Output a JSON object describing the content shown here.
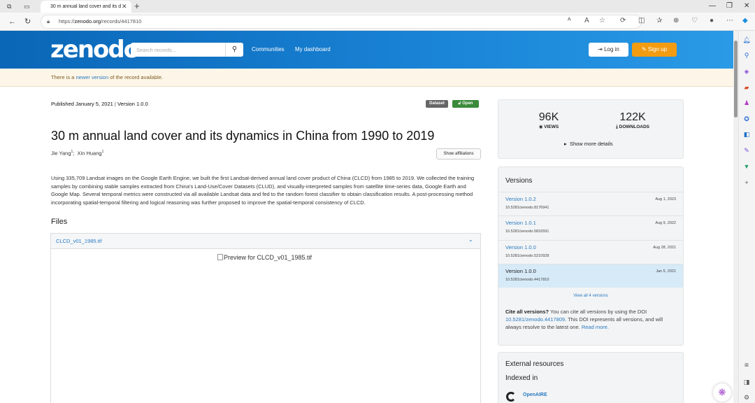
{
  "browser": {
    "tab_title": "30 m annual land cover and its d",
    "url_prefix": "https://",
    "url_domain": "zenodo.org",
    "url_path": "/records/4417810"
  },
  "header": {
    "logo": "zenodo",
    "search_placeholder": "Search records...",
    "nav": [
      "Communities",
      "My dashboard"
    ],
    "login": "Log in",
    "signup": "Sign up"
  },
  "banner": {
    "pre": "There is a ",
    "link": "newer version",
    "post": " of the record available."
  },
  "record": {
    "published": "Published January 5, 2021",
    "sep": " | ",
    "version": "Version 1.0.0",
    "badge_type": "Dataset",
    "badge_access": "Open",
    "title": "30 m annual land cover and its dynamics in China from 1990 to 2019",
    "author1": "Jie Yang",
    "author1_sup": "1",
    "author2": "Xin Huang",
    "author2_sup": "1",
    "affiliations_btn": "Show affiliations",
    "description": "Using 335,709 Landsat images on the Google Earth Engine, we built the first Landsat-derived annual land cover product of China (CLCD) from 1985 to 2019. We collected the training samples by combining stable samples extracted from China's Land-Use/Cover Datasets (CLUD), and visually-interpreted samples from satellite time-series data, Google Earth and Google Map. Several temporal metrics were constructed via all available Landsat data and fed to the random forest classifier to obtain classification results. A post-processing method incorporating spatial-temporal filtering and logical reasoning was further proposed to improve the spatial-temporal consistency of CLCD."
  },
  "files": {
    "heading": "Files",
    "filename": "CLCD_v01_1985.tif",
    "preview_alt": "Preview for CLCD_v01_1985.tif"
  },
  "stats": {
    "views": "96K",
    "views_label": "VIEWS",
    "downloads": "122K",
    "downloads_label": "DOWNLOADS",
    "more": "Show more details"
  },
  "versions": {
    "heading": "Versions",
    "items": [
      {
        "label": "Version 1.0.2",
        "doi": "10.5281/zenodo.8176941",
        "date": "Aug 1, 2023"
      },
      {
        "label": "Version 1.0.1",
        "doi": "10.5281/zenodo.5816591",
        "date": "Aug 9, 2022"
      },
      {
        "label": "Version 1.0.0",
        "doi": "10.5281/zenodo.5210928",
        "date": "Aug 28, 2021"
      },
      {
        "label": "Version 1.0.0",
        "doi": "10.5281/zenodo.4417810",
        "date": "Jan 5, 2021"
      }
    ],
    "view_all": "View all 4 versions",
    "cite_bold": "Cite all versions?",
    "cite_text1": " You can cite all versions by using the DOI ",
    "cite_doi": "10.5281/zenodo.4417809",
    "cite_text2": ". This DOI represents all versions, and will always resolve to the latest one. ",
    "cite_more": "Read more."
  },
  "external": {
    "heading": "External resources",
    "indexed": "Indexed in",
    "openaire": "OpenAIRE"
  },
  "colors": {
    "header_blue": "#0a66b7",
    "signup_orange": "#f39c12",
    "link_blue": "#2a7bc0",
    "open_green": "#3a8a3a",
    "dataset_grey": "#666666"
  }
}
